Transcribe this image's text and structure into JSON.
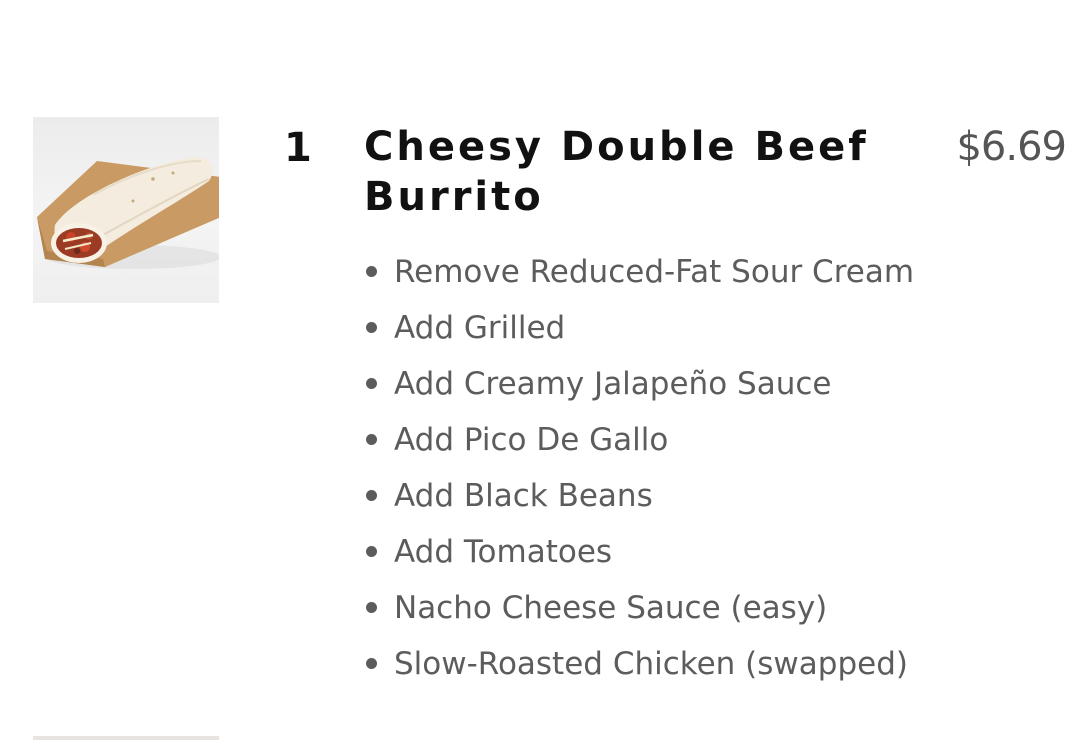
{
  "item": {
    "image_alt": "Cheesy Double Beef Burrito",
    "quantity": "1",
    "name": "Cheesy Double Beef Burrito",
    "price": "$6.69",
    "modifications": [
      "Remove Reduced-Fat Sour Cream",
      "Add Grilled",
      "Add Creamy Jalapeño Sauce",
      "Add Pico De Gallo",
      "Add Black Beans",
      "Add Tomatoes",
      "Nacho Cheese Sauce (easy)",
      "Slow-Roasted Chicken (swapped)"
    ]
  },
  "colors": {
    "title_text": "#111111",
    "price_text": "#555555",
    "modifier_text": "#5c5c5c",
    "background": "#ffffff"
  }
}
